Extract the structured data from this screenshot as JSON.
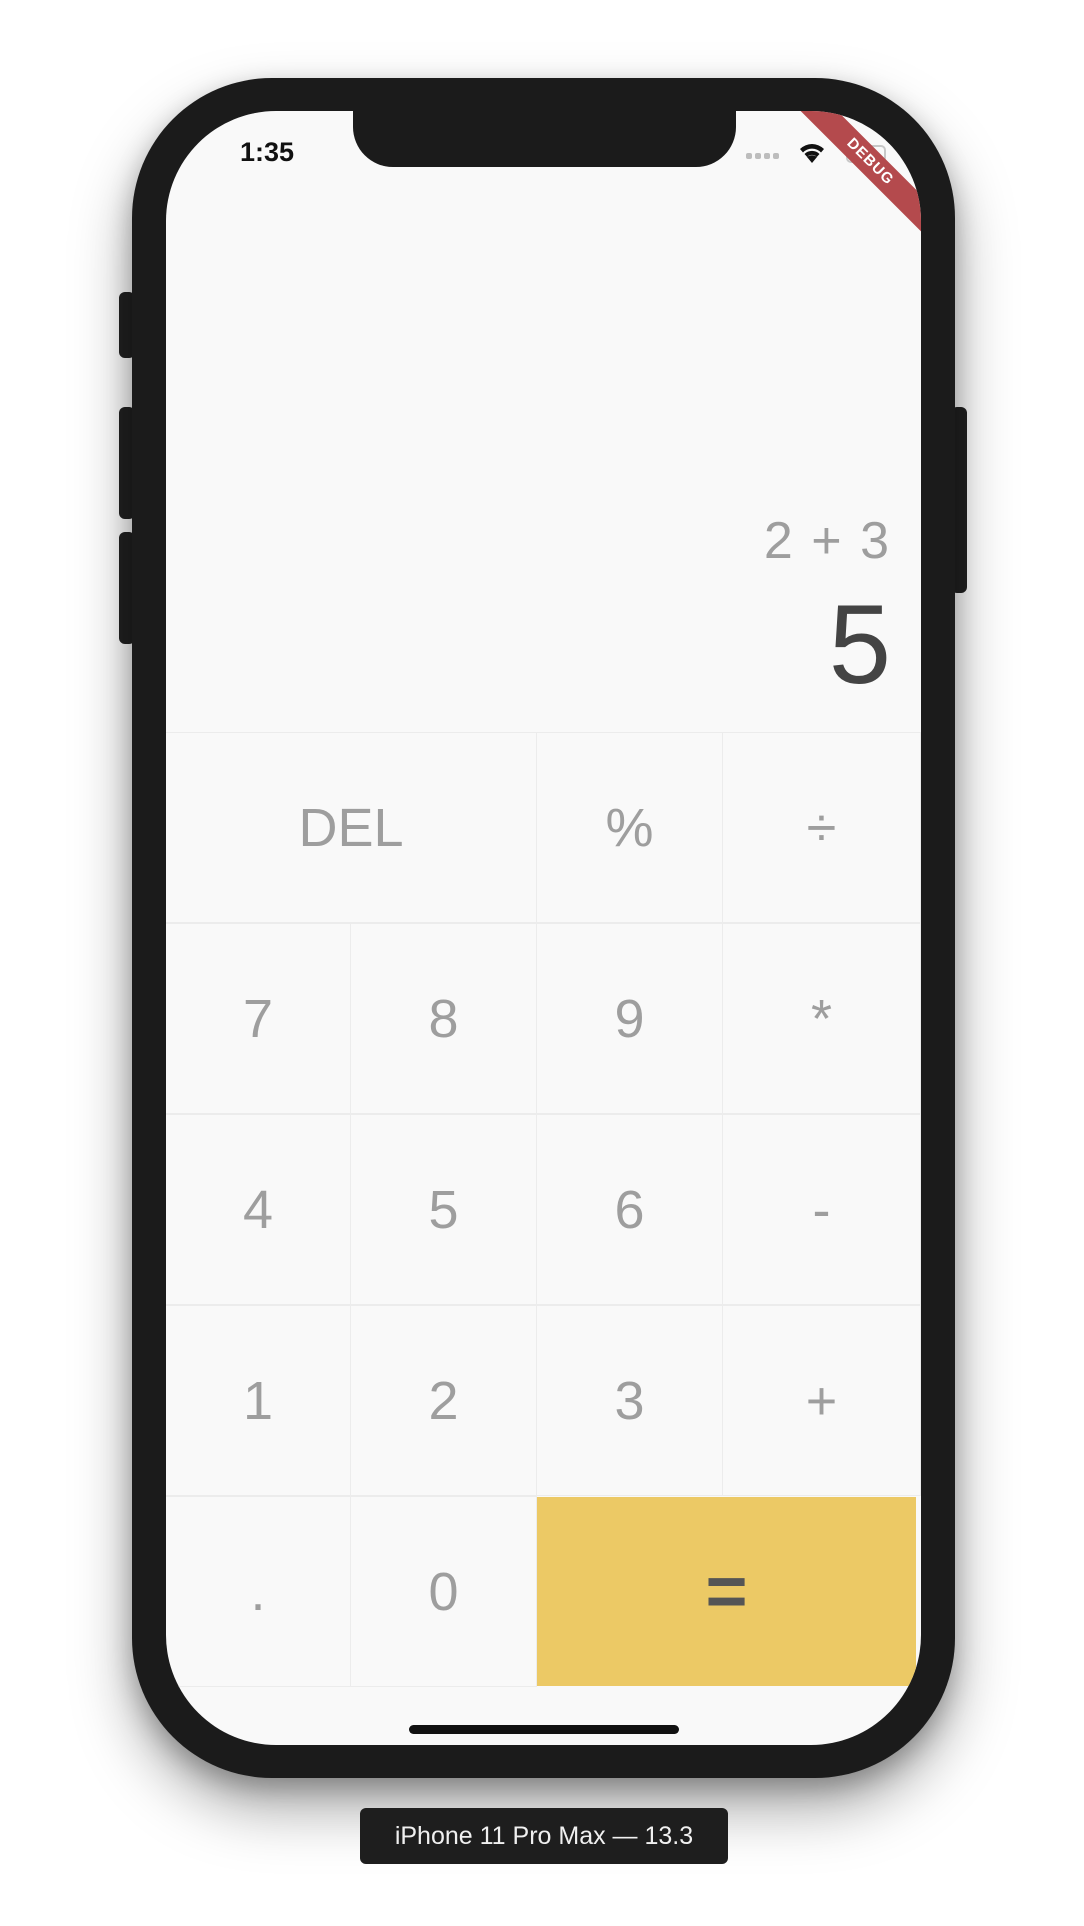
{
  "status_bar": {
    "time": "1:35"
  },
  "debug_banner": "DEBUG",
  "display": {
    "expression": "2 + 3",
    "result": "5"
  },
  "keys": {
    "del": "DEL",
    "percent": "%",
    "divide": "÷",
    "seven": "7",
    "eight": "8",
    "nine": "9",
    "multiply": "*",
    "four": "4",
    "five": "5",
    "six": "6",
    "minus": "-",
    "one": "1",
    "two": "2",
    "three": "3",
    "plus": "+",
    "dot": ".",
    "zero": "0",
    "equals": "="
  },
  "device_label": "iPhone 11 Pro Max — 13.3",
  "colors": {
    "equals_button": "#ecc965",
    "key_text": "#9e9e9e",
    "result_text": "#444444",
    "debug_banner": "#b44a4d"
  },
  "icons": {
    "signal": "cellular-signal-icon",
    "wifi": "wifi-icon",
    "battery": "battery-low-icon"
  }
}
